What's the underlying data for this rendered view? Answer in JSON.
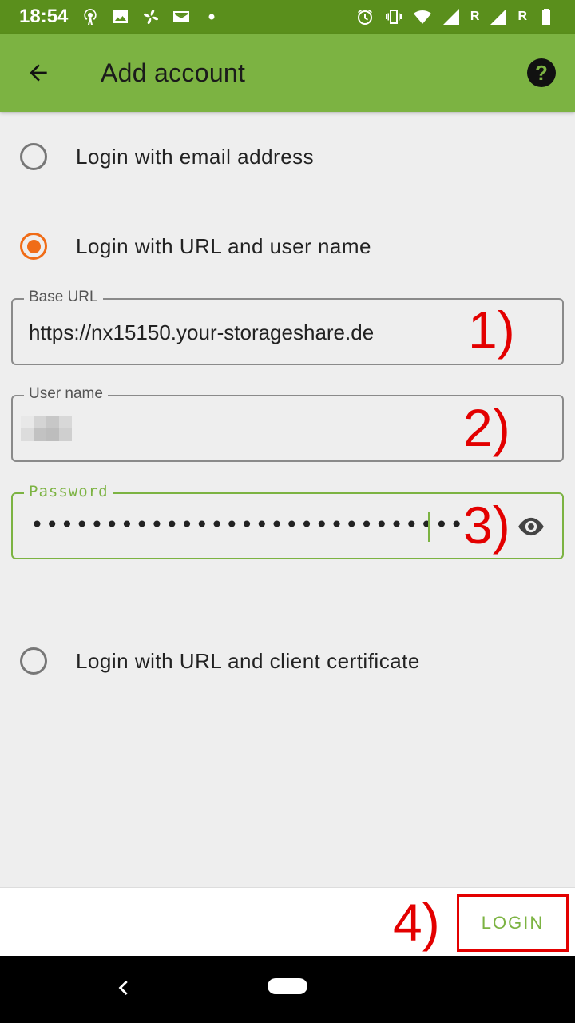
{
  "status_bar": {
    "time": "18:54",
    "left_icons": [
      "hotspot-icon",
      "image-icon",
      "fan-icon",
      "mail-icon",
      "dot-icon"
    ],
    "right_icons": [
      "alarm-icon",
      "vibrate-icon",
      "wifi-icon",
      "signal-icon",
      "signal-icon",
      "battery-icon"
    ],
    "roaming_label_1": "R",
    "roaming_label_2": "R"
  },
  "app_bar": {
    "title": "Add account",
    "help_icon_label": "?",
    "background_color": "#7cb342"
  },
  "options": [
    {
      "label": "Login with email address",
      "checked": false
    },
    {
      "label": "Login with URL and user name",
      "checked": true
    },
    {
      "label": "Login with URL and client certificate",
      "checked": false
    }
  ],
  "fields": {
    "base_url": {
      "label": "Base URL",
      "value": "https://nx15150.your-storageshare.de"
    },
    "user_name": {
      "label": "User name",
      "value": ""
    },
    "password": {
      "label": "Password",
      "value": "•••••••••••••••••••••••••••••"
    }
  },
  "annotations": [
    "1)",
    "2)",
    "3)",
    "4)"
  ],
  "actions": {
    "login_label": "LOGIN"
  },
  "colors": {
    "accent": "#7cb342",
    "radio_checked": "#f06c17",
    "annotation": "#e30000"
  }
}
